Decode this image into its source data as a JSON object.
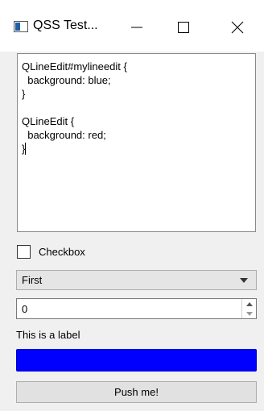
{
  "window": {
    "title": "QSS Test...",
    "icon": "app-window-icon",
    "controls": [
      "minimize-icon",
      "maximize-icon",
      "close-icon"
    ]
  },
  "editor": {
    "lines": [
      "QLineEdit#mylineedit {",
      "  background: blue;",
      "}",
      "",
      "QLineEdit {",
      "  background: red;",
      "}"
    ]
  },
  "checkbox": {
    "label": "Checkbox",
    "checked": false
  },
  "combo": {
    "selected": "First"
  },
  "spinbox": {
    "value": "0"
  },
  "label": {
    "text": "This is a label"
  },
  "line_edit": {
    "value": "",
    "background": "#0000ff"
  },
  "button": {
    "label": "Push me!"
  }
}
